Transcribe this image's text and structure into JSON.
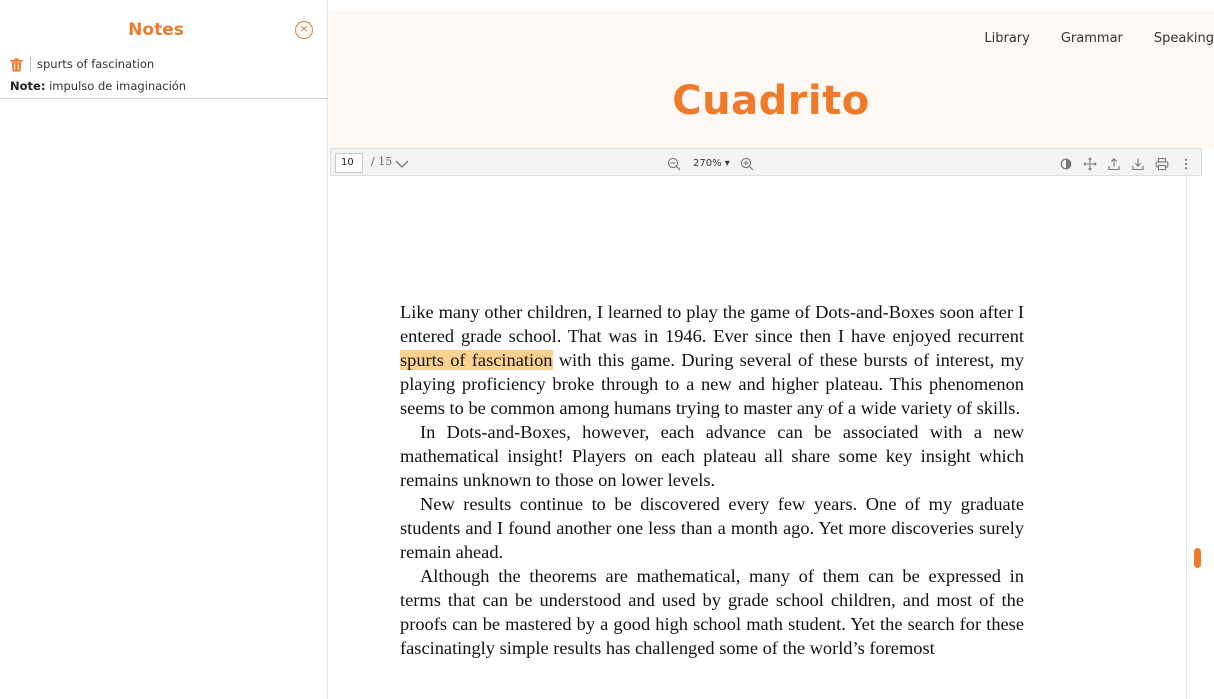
{
  "sidebar": {
    "title": "Notes",
    "close_symbol": "×",
    "notes": [
      {
        "word": "spurts of fascination",
        "note_label": "Note:",
        "note_text": " impulso de imaginación"
      }
    ]
  },
  "nav": {
    "links": [
      "Library",
      "Grammar",
      "Speaking"
    ]
  },
  "brand": "Cuadrito",
  "viewer": {
    "current_page": "10",
    "page_total": "/ 15",
    "zoom": "270% ▾",
    "icons": [
      "zoom-out-icon",
      "zoom-in-icon",
      "theme-toggle-icon",
      "move-icon",
      "upload-icon",
      "download-icon",
      "print-icon",
      "more-options-icon"
    ]
  },
  "document": {
    "p1_before": "Like many other children, I learned to play the game of Dots-and-Boxes soon after I entered grade school. That was in 1946. Ever since then I have enjoyed recurrent ",
    "p1_highlight": "spurts of fascination",
    "p1_after": " with this game. During several of these bursts of interest, my playing proficiency broke through to a new and higher plateau. This phenomenon seems to be common among humans trying to master any of a wide variety of skills.",
    "p2": "In Dots-and-Boxes, however, each advance can be associated with a new mathematical insight! Players on each plateau all share some key insight which remains unknown to those on lower levels.",
    "p3": "New results continue to be discovered every few years. One of my graduate students and I found another one less than a month ago. Yet more discoveries surely remain ahead.",
    "p4": "Although the theorems are mathematical, many of them can be expressed in terms that can be understood and used by grade school children, and most of the proofs can be mastered by a good high school math student. Yet the search for these fascinatingly simple results has challenged some of the world’s foremost"
  },
  "colors": {
    "accent": "#ee7a2a",
    "highlight": "#fbd18f",
    "topbar_bg": "#fdf8f3"
  }
}
